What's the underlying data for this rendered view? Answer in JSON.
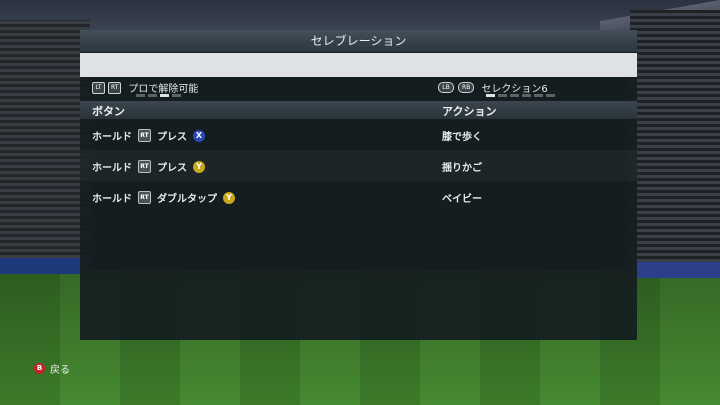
{
  "panel": {
    "title": "セレブレーション"
  },
  "subheader": {
    "left_buttons": [
      "LT",
      "RT"
    ],
    "left_label": "プロで解除可能",
    "right_buttons": [
      "LB",
      "RB"
    ],
    "right_label": "セレクション6",
    "left_page": 3,
    "left_total": 4,
    "right_page": 1,
    "right_total": 6
  },
  "columns": {
    "button": "ボタン",
    "action": "アクション"
  },
  "rows": [
    {
      "hold": "ホールド",
      "trigger": "RT",
      "input": "プレス",
      "face": "X",
      "face_color": "#2a49b8",
      "action": "膝で歩く"
    },
    {
      "hold": "ホールド",
      "trigger": "RT",
      "input": "プレス",
      "face": "Y",
      "face_color": "#c9a81c",
      "action": "揺りかご"
    },
    {
      "hold": "ホールド",
      "trigger": "RT",
      "input": "ダブルタップ",
      "face": "Y",
      "face_color": "#c9a81c",
      "action": "ベイビー"
    }
  ],
  "footer": {
    "back_button": "B",
    "back_label": "戻る"
  },
  "colors": {
    "b_button": "#c8202a",
    "x_button": "#2a49b8",
    "y_button": "#c9a81c"
  }
}
